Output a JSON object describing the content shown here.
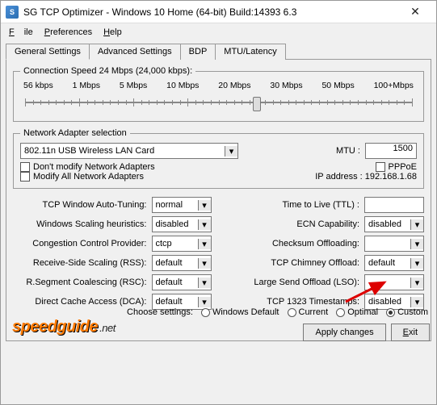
{
  "window": {
    "title": "SG TCP Optimizer - Windows 10 Home (64-bit) Build:14393 6.3",
    "icon_letter": "S"
  },
  "menu": {
    "file": "File",
    "preferences": "Preferences",
    "help": "Help"
  },
  "tabs": {
    "general": "General Settings",
    "advanced": "Advanced Settings",
    "bdp": "BDP",
    "mtu": "MTU/Latency"
  },
  "speed": {
    "label": "Connection Speed  24 Mbps (24,000 kbps):",
    "ticks": [
      "56 kbps",
      "1 Mbps",
      "5 Mbps",
      "10 Mbps",
      "20 Mbps",
      "30 Mbps",
      "50 Mbps",
      "100+Mbps"
    ],
    "thumb_pct": 60
  },
  "adapter": {
    "legend": "Network Adapter selection",
    "selected": "802.11n USB Wireless LAN Card",
    "mtu_label": "MTU :",
    "mtu_value": "1500",
    "dont_modify": "Don't modify Network Adapters",
    "modify_all": "Modify All Network Adapters",
    "pppoe": "PPPoE",
    "ip_label": "IP address :",
    "ip_value": "192.168.1.68"
  },
  "left": {
    "auto_tuning": {
      "lbl": "TCP Window Auto-Tuning:",
      "val": "normal"
    },
    "scaling": {
      "lbl": "Windows Scaling heuristics:",
      "val": "disabled"
    },
    "congestion": {
      "lbl": "Congestion Control Provider:",
      "val": "ctcp"
    },
    "rss": {
      "lbl": "Receive-Side Scaling (RSS):",
      "val": "default"
    },
    "rsc": {
      "lbl": "R.Segment Coalescing (RSC):",
      "val": "default"
    },
    "dca": {
      "lbl": "Direct Cache Access (DCA):",
      "val": "default"
    }
  },
  "right": {
    "ttl": {
      "lbl": "Time to Live (TTL) :",
      "val": ""
    },
    "ecn": {
      "lbl": "ECN Capability:",
      "val": "disabled"
    },
    "checksum": {
      "lbl": "Checksum Offloading:",
      "val": ""
    },
    "chimney": {
      "lbl": "TCP Chimney Offload:",
      "val": "default"
    },
    "lso": {
      "lbl": "Large Send Offload (LSO):",
      "val": ""
    },
    "timestamps": {
      "lbl": "TCP 1323 Timestamps:",
      "val": "disabled"
    }
  },
  "choose": {
    "label": "Choose settings:",
    "windows": "Windows Default",
    "current": "Current",
    "optimal": "Optimal",
    "custom": "Custom"
  },
  "buttons": {
    "apply": "Apply changes",
    "exit": "Exit"
  },
  "logo": {
    "a": "speedguide",
    "b": ".net"
  }
}
